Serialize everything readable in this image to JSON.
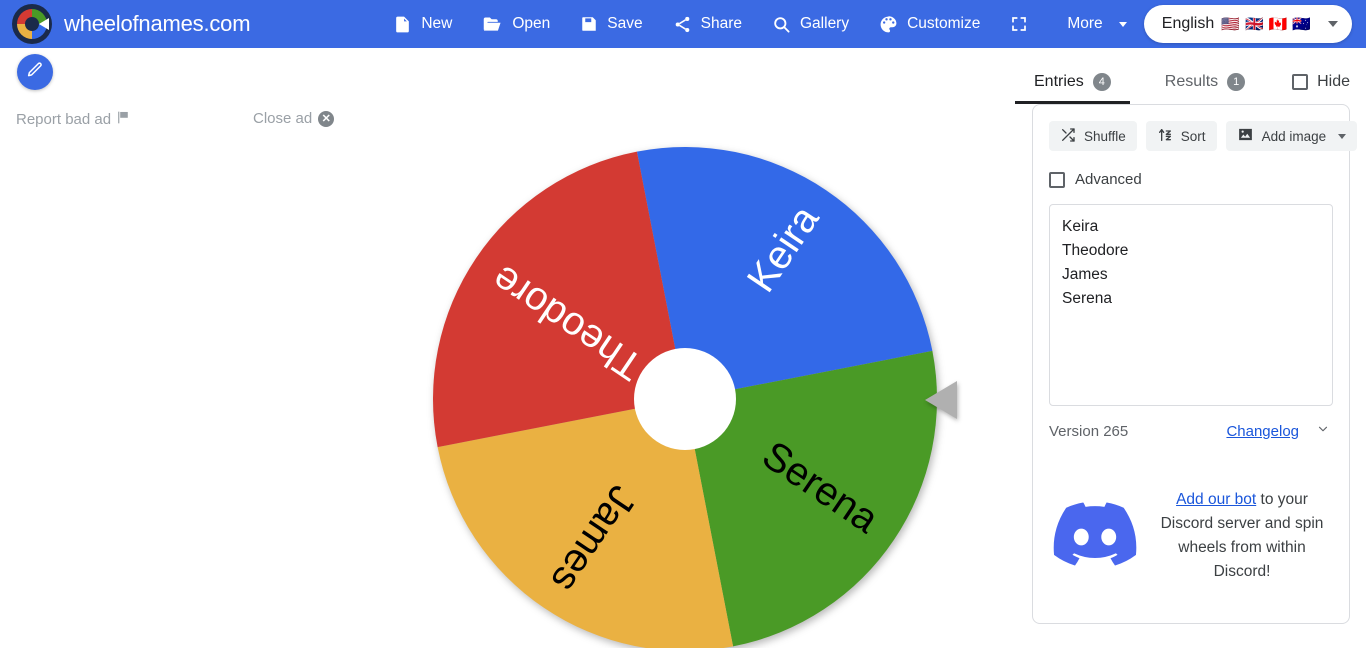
{
  "header": {
    "brand": "wheelofnames.com",
    "logo_icon": "wheel-logo-icon",
    "nav": [
      {
        "label": "New",
        "icon": "file-icon"
      },
      {
        "label": "Open",
        "icon": "folder-open-icon"
      },
      {
        "label": "Save",
        "icon": "floppy-disk-icon"
      },
      {
        "label": "Share",
        "icon": "share-nodes-icon"
      },
      {
        "label": "Gallery",
        "icon": "search-icon"
      },
      {
        "label": "Customize",
        "icon": "palette-icon"
      },
      {
        "label": "",
        "icon": "fullscreen-icon"
      },
      {
        "label": "More",
        "icon": "chevron-down-icon"
      }
    ],
    "language": {
      "label": "English",
      "flags": [
        "🇺🇸",
        "🇬🇧",
        "🇨🇦",
        "🇦🇺"
      ],
      "caret_icon": "caret-down-icon"
    }
  },
  "ad": {
    "report_label": "Report bad ad",
    "report_icon": "flag-icon",
    "close_label": "Close ad",
    "close_icon": "close-circle-icon"
  },
  "edit_fab": {
    "icon": "pencil-icon"
  },
  "wheel": {
    "hub_label": "",
    "pointer_icon": "triangle-pointer-icon",
    "segments": [
      {
        "label": "Keira",
        "color": "#3369e8",
        "text_color": "#ffffff",
        "start_deg": -101,
        "end_deg": -11
      },
      {
        "label": "Serena",
        "color": "#4a9a26",
        "text_color": "#000000",
        "start_deg": -11,
        "end_deg": 79
      },
      {
        "label": "James",
        "color": "#eab142",
        "text_color": "#000000",
        "start_deg": 79,
        "end_deg": 169
      },
      {
        "label": "Theodore",
        "color": "#d33a33",
        "text_color": "#ffffff",
        "start_deg": 169,
        "end_deg": 259
      }
    ]
  },
  "panel": {
    "tabs": [
      {
        "label": "Entries",
        "badge": "4",
        "active": true
      },
      {
        "label": "Results",
        "badge": "1",
        "active": false
      }
    ],
    "hide_label": "Hide",
    "tools": [
      {
        "label": "Shuffle",
        "icon": "shuffle-icon"
      },
      {
        "label": "Sort",
        "icon": "sort-az-icon"
      },
      {
        "label": "Add image",
        "icon": "image-icon",
        "has_caret": true
      }
    ],
    "advanced_label": "Advanced",
    "entries": [
      "Keira",
      "Theodore",
      "James",
      "Serena"
    ],
    "version": "Version 265",
    "changelog_label": "Changelog",
    "changelog_chevron": "⌄",
    "discord": {
      "icon": "discord-icon",
      "link_label": "Add our bot",
      "text_after": " to your Discord server and spin wheels from within Discord!"
    }
  },
  "colors": {
    "header_blue": "#3b6ae3",
    "accent_blue": "#1a56db",
    "segment_blue": "#3369e8",
    "segment_green": "#4a9a26",
    "segment_yellow": "#eab142",
    "segment_red": "#d33a33",
    "discord_blue": "#4a67ee"
  }
}
